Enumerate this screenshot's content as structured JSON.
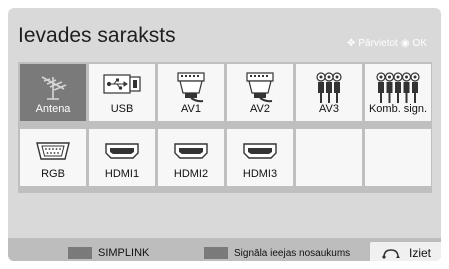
{
  "window": {
    "title": "Ievades saraksts"
  },
  "hint": {
    "move_label": "Pārvietot",
    "ok_label": "OK",
    "move_icon": "dpad-icon",
    "ok_icon": "ok-circle-icon"
  },
  "inputs": {
    "row1": [
      {
        "label": "Antena",
        "icon": "antenna-icon",
        "selected": true
      },
      {
        "label": "USB",
        "icon": "usb-icon",
        "selected": false
      },
      {
        "label": "AV1",
        "icon": "scart-icon",
        "selected": false
      },
      {
        "label": "AV2",
        "icon": "scart-icon",
        "selected": false
      },
      {
        "label": "AV3",
        "icon": "rca-icon",
        "selected": false
      },
      {
        "label": "Komb. sign.",
        "icon": "component-icon",
        "selected": false
      }
    ],
    "row2": [
      {
        "label": "RGB",
        "icon": "vga-icon"
      },
      {
        "label": "HDMI1",
        "icon": "hdmi-icon"
      },
      {
        "label": "HDMI2",
        "icon": "hdmi-icon"
      },
      {
        "label": "HDMI3",
        "icon": "hdmi-icon"
      },
      {
        "label": "",
        "icon": ""
      },
      {
        "label": "",
        "icon": ""
      }
    ]
  },
  "footer": {
    "simplink_label": "SIMPLINK",
    "rename_label": "Signāla ieejas nosaukums",
    "exit_label": "Iziet",
    "exit_icon": "back-arrow-icon"
  },
  "colors": {
    "panel": "#d9d9d9",
    "tile": "#f7f7f7",
    "selected_tile": "#7a7a7a",
    "accent_hint": "#ffffff"
  }
}
